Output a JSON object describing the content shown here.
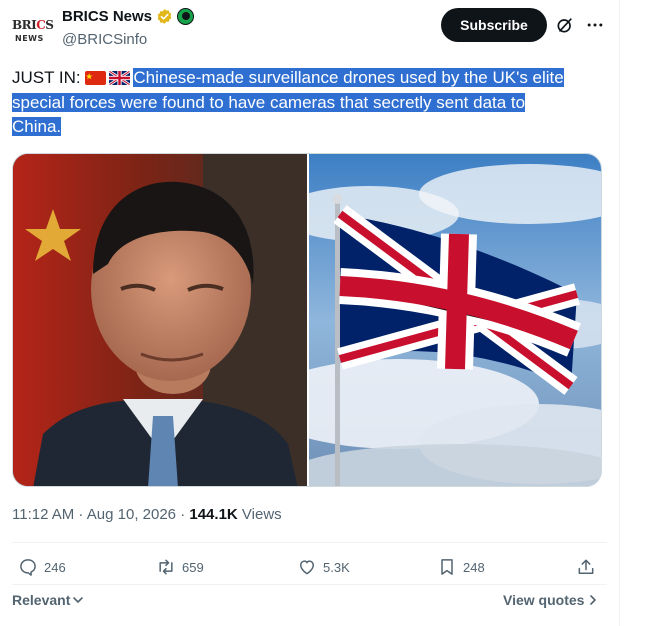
{
  "account": {
    "avatar_brand": "BRICS",
    "avatar_sub": "NEWS",
    "display_name": "BRICS News",
    "handle": "@BRICSinfo"
  },
  "header": {
    "subscribe_label": "Subscribe",
    "icons": [
      "verified-badge-icon",
      "affiliate-badge-icon",
      "grok-icon",
      "more-icon"
    ]
  },
  "tweet": {
    "prefix": "JUST IN:",
    "flags": [
      "China flag",
      "United Kingdom flag"
    ],
    "line1": "Chinese-made surveillance drones used by the UK's elite",
    "line2": "special forces were found to have cameras that secretly sent data to",
    "line3": "China."
  },
  "meta": {
    "time": "11:12 AM",
    "sep1": " · ",
    "date": "Aug 10, 2026",
    "sep2": " · ",
    "views_count": "144.1K",
    "views_label": " Views"
  },
  "actions": {
    "replies": "246",
    "reposts": "659",
    "likes": "5.3K",
    "bookmarks": "248"
  },
  "footer": {
    "sort_label": "Relevant",
    "view_quotes_label": "View quotes"
  },
  "colors": {
    "highlight": "#2f6fd1",
    "text": "#0f1419",
    "secondary": "#536471",
    "subscribe_bg": "#0f1419",
    "verified_gold": "#e2b719"
  }
}
